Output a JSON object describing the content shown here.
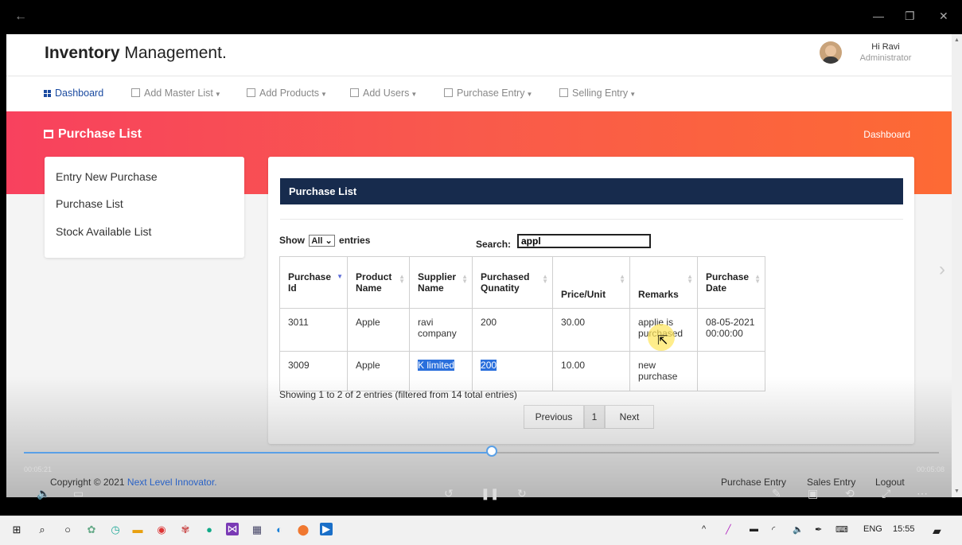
{
  "header": {
    "brand_bold": "Inventory",
    "brand_rest": " Management.",
    "user_greeting": "Hi Ravi",
    "user_role": "Administrator"
  },
  "nav": [
    {
      "label": "Dashboard"
    },
    {
      "label": "Add Master List"
    },
    {
      "label": "Add Products"
    },
    {
      "label": "Add Users"
    },
    {
      "label": "Purchase Entry"
    },
    {
      "label": "Selling Entry"
    }
  ],
  "banner": {
    "title": "Purchase List",
    "link": "Dashboard"
  },
  "sidebar": [
    "Entry New Purchase",
    "Purchase List",
    "Stock Available List"
  ],
  "card": {
    "title": "Purchase List",
    "show_prefix": "Show",
    "show_value": "All",
    "show_suffix": "entries",
    "search_label": "Search:",
    "search_value": "appl",
    "columns": [
      "Purchase Id",
      "Product Name",
      "Supplier Name",
      "Purchased Qunatity",
      "Price/Unit",
      "Remarks",
      "Purchase Date"
    ],
    "rows": [
      [
        "3011",
        "Apple",
        "ravi company",
        "200",
        "30.00",
        "applie is purchased",
        "08-05-2021 00:00:00"
      ],
      [
        "3009",
        "Apple",
        "K limited",
        "200",
        "10.00",
        "new purchase",
        ""
      ]
    ],
    "info": "Showing 1 to 2 of 2 entries (filtered from 14 total entries)",
    "pager": {
      "prev": "Previous",
      "page": "1",
      "next": "Next"
    }
  },
  "footer": {
    "copyright_prefix": "Copyright © 2021 ",
    "company": "Next Level Innovator.",
    "links": [
      "Purchase Entry",
      "Sales Entry",
      "Logout"
    ]
  },
  "video": {
    "elapsed": "00:05:21",
    "remaining": "00:05:08"
  },
  "taskbar": {
    "language": "ENG",
    "time": "15:55"
  }
}
